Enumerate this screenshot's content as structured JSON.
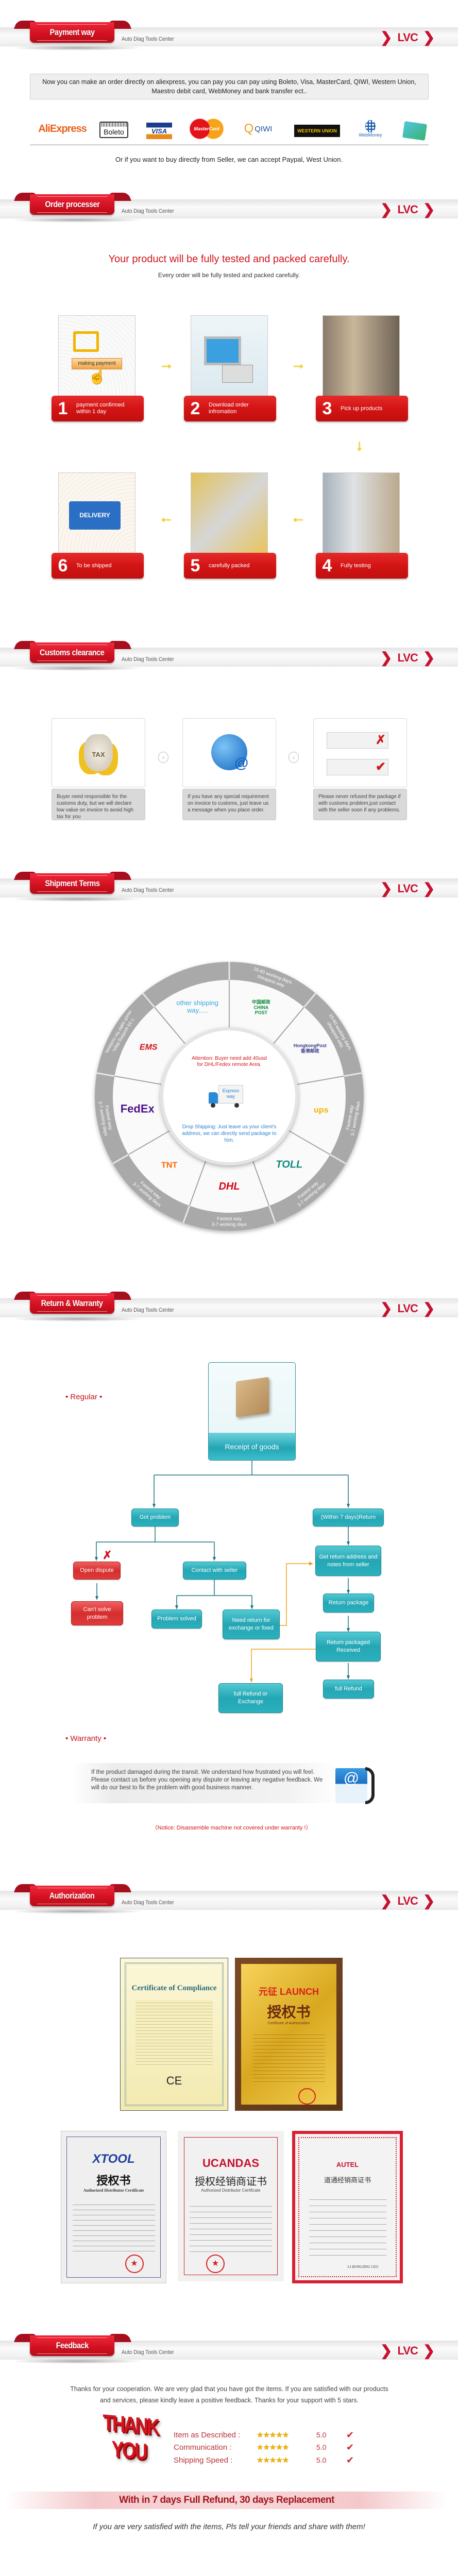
{
  "brand": {
    "subtitle": "Auto Diag Tools Center",
    "logo": "LVC",
    "chevron": "❯"
  },
  "payment": {
    "title": "Payment way",
    "notice": "Now you can make an order directly on aliexpress, you can pay you can pay using Boleto, Visa, MasterCard, QIWI, Western Union, Maestro debit card, WebMoney and bank transfer ect..",
    "logos": [
      "AliExpress",
      "Boleto",
      "VISA",
      "MasterCard",
      "QIWI",
      "WESTERN UNION",
      "WebMoney",
      "bank-card-icon"
    ],
    "footer": "Or if you want to buy directly from Seller, we can accept Paypal, West Union."
  },
  "order": {
    "title": "Order processer",
    "headline": "Your product will be fully tested and packed carefully.",
    "subline": "Every order will be fully tested and packed carefully.",
    "payment_button": "making payment",
    "delivery_sign": "DELIVERY",
    "steps": [
      {
        "num": "1",
        "label": "payment confirmed within 1 day"
      },
      {
        "num": "2",
        "label": "Download order infromation"
      },
      {
        "num": "3",
        "label": "Pick up products"
      },
      {
        "num": "4",
        "label": "Fully testing"
      },
      {
        "num": "5",
        "label": "carefully packed"
      },
      {
        "num": "6",
        "label": "To be shipped"
      }
    ]
  },
  "customs": {
    "title": "Customs clearance",
    "tax_label": "TAX",
    "items": [
      "Buyer need responsible for the customs duty, but we will declare low value on invoice to avoid high tax for you",
      "If you have any special requirement on invoice to customs, just leave us a message when you place order.",
      "Please never refused the package if with customs problem,just contact with the seller soon if any problems."
    ]
  },
  "shipment": {
    "title": "Shipment Terms",
    "attention": "Attention: Buyer need add 40usd for DHL/Fedex remote Area.",
    "express": "Express way",
    "drop": "Drop Shipping: Just leave us your client's address, we can directly send package to him.",
    "segments": [
      {
        "carrier": "中国邮政 CHINA POST",
        "ring1": "15-60 working days,",
        "ring2": "cheapest way."
      },
      {
        "carrier": "HongkongPost 香港邮政",
        "ring1": "15-60 working days,",
        "ring2": "cheapest way."
      },
      {
        "carrier": "ups",
        "ring1": "Fastest way",
        "ring2": "3-7 working days"
      },
      {
        "carrier": "TOLL",
        "ring1": "Fastest way",
        "ring2": "3-7 working days"
      },
      {
        "carrier": "DHL",
        "ring1": "Fastest way",
        "ring2": "3-7 working days"
      },
      {
        "carrier": "TNT",
        "ring1": "Fastest way",
        "ring2": "3-7 working days"
      },
      {
        "carrier": "FedEx",
        "ring1": "Fastest way",
        "ring2": "3-7 working days"
      },
      {
        "carrier": "EMS",
        "ring1": "7-15 working days,",
        "ring2": "much safer for customs."
      },
      {
        "carrier": "other shipping way.....",
        "ring1": "",
        "ring2": ""
      }
    ],
    "colors": {
      "ring": "#a9a9a9",
      "attention": "#d0161d",
      "drop": "#2a7fd4"
    }
  },
  "return": {
    "title": "Return & Warranty",
    "regular": "• Regular •",
    "receipt": "Receipt of goods",
    "nodes": {
      "got_problem": "Got problem",
      "return7": "(Within 7 days)Return",
      "open_dispute": "Open dispute",
      "contact": "Contact with seller",
      "cant_solve": "Can't solve problem",
      "solved": "Problem solved",
      "need_return": "Need return for exchange or fixed",
      "get_address": "Get return address and notes from seller",
      "return_package": "Return package",
      "received": "Return packaged Received",
      "refund_exchange": "full Refund or Exchange",
      "full_refund": "full Refund"
    },
    "warranty": "• Warranty •",
    "warranty_text": "If the product damaged during the transit. We understand how frustrated you will feel. Please contact us before you opening any dispute or leaving any negative feedback. We will do our best to fix the problem with good business manner.",
    "notice": "（Notice: Disassemble machine not covered under warranty !）"
  },
  "authorization": {
    "title": "Authorization",
    "certs": [
      {
        "brand": "Certificate of Compliance",
        "sub": "CE"
      },
      {
        "brand": "元征 LAUNCH",
        "sub": "授权书",
        "en": "Certificate of Authorization"
      },
      {
        "brand": "XTOOL",
        "sub": "授权书",
        "en": "Authorized Distributor Certificate"
      },
      {
        "brand": "UCANDAS",
        "sub": "授权经销商证书",
        "en": "Authorized Distributor Certificate"
      },
      {
        "brand": "AUTEL",
        "sub": "道通经销商证书",
        "en": "LI HONGJING CEO"
      }
    ]
  },
  "feedback": {
    "title": "Feedback",
    "text": "Thanks for your cooperation. We are very glad that you have got the items. If you are satisfied with our products and services, please kindly leave a positive feedback. Thanks for your support with 5 stars.",
    "thank_you": "THANK YOU",
    "ratings": [
      {
        "label": "Item as Described :",
        "stars": 5,
        "value": "5.0"
      },
      {
        "label": "Communication :",
        "stars": 5,
        "value": "5.0"
      },
      {
        "label": "Shipping Speed :",
        "stars": 5,
        "value": "5.0"
      }
    ],
    "banner": "With  in  7 days Full Refund, 30 days Replacement",
    "share": "If you are very satisfied with the items, Pls tell your friends and share with them!"
  }
}
